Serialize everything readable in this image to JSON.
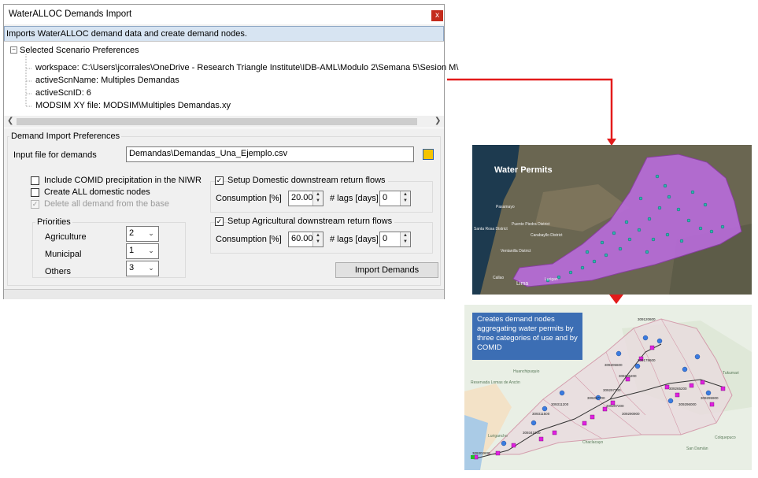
{
  "dialog": {
    "title": "WaterALLOC Demands Import",
    "close_glyph": "x",
    "info": "Imports WaterALLOC demand data and create demand nodes.",
    "tree": {
      "root": "Selected Scenario Preferences",
      "items": [
        "workspace: C:\\Users\\jcorrales\\OneDrive - Research Triangle Institute\\IDB-AML\\Modulo 2\\Semana 5\\Sesion M\\",
        "activeScnName: Multiples Demandas",
        "activeScnID: 6",
        "MODSIM XY file: MODSIM\\Multiples Demandas.xy"
      ]
    },
    "import_prefs": {
      "group_label": "Demand Import Preferences",
      "input_label": "Input file for demands",
      "input_value": "Demandas\\Demandas_Una_Ejemplo.csv",
      "include_comid": "Include COMID precipitation in the NIWR",
      "create_all": "Create ALL domestic nodes",
      "delete_all": "Delete all demand from the base",
      "priorities": {
        "label": "Priorities",
        "rows": [
          {
            "name": "Agriculture",
            "value": "2"
          },
          {
            "name": "Municipal",
            "value": "1"
          },
          {
            "name": "Others",
            "value": "3"
          }
        ]
      },
      "domestic": {
        "label": "Setup Domestic downstream return flows",
        "consumption_label": "Consumption [%]",
        "consumption_value": "20.00",
        "lags_label": "# lags [days]",
        "lags_value": "0"
      },
      "agricultural": {
        "label": "Setup Agricultural downstream return flows",
        "consumption_label": "Consumption [%]",
        "consumption_value": "60.00",
        "lags_label": "# lags [days]",
        "lags_value": "0"
      },
      "import_button": "Import Demands"
    }
  },
  "water_permits_image": {
    "title": "Water Permits",
    "places": [
      "Pasamayo",
      "Santa Rosa District",
      "Puente Piedra District",
      "Ventanilla District",
      "Carabayllo District",
      "Callao",
      "Lima",
      "Lurigan"
    ]
  },
  "demand_nodes_image": {
    "callout": "Creates demand nodes aggregating water permits by three categories of use and by COMID",
    "node_ids": [
      "309120600",
      "309178600",
      "309205600",
      "309205200",
      "309297700",
      "309257700",
      "309297200",
      "309290900",
      "309295900",
      "309311200",
      "309311500",
      "309302600",
      "309296000",
      "309341000",
      "309265200"
    ],
    "places": [
      "Reservada Lomas de Ancón",
      "Huanchipuquio",
      "Chaclacayo",
      "Colquepuco",
      "Tukumari",
      "San Damián",
      "Lurigancho"
    ]
  },
  "colors": {
    "arrow": "#e31b1b",
    "watershed": "#b96cdc",
    "permits": "#2fb3b1",
    "callout": "#3c6eb4",
    "nodes_magenta": "#e020e0",
    "nodes_blue": "#3a7be0"
  }
}
